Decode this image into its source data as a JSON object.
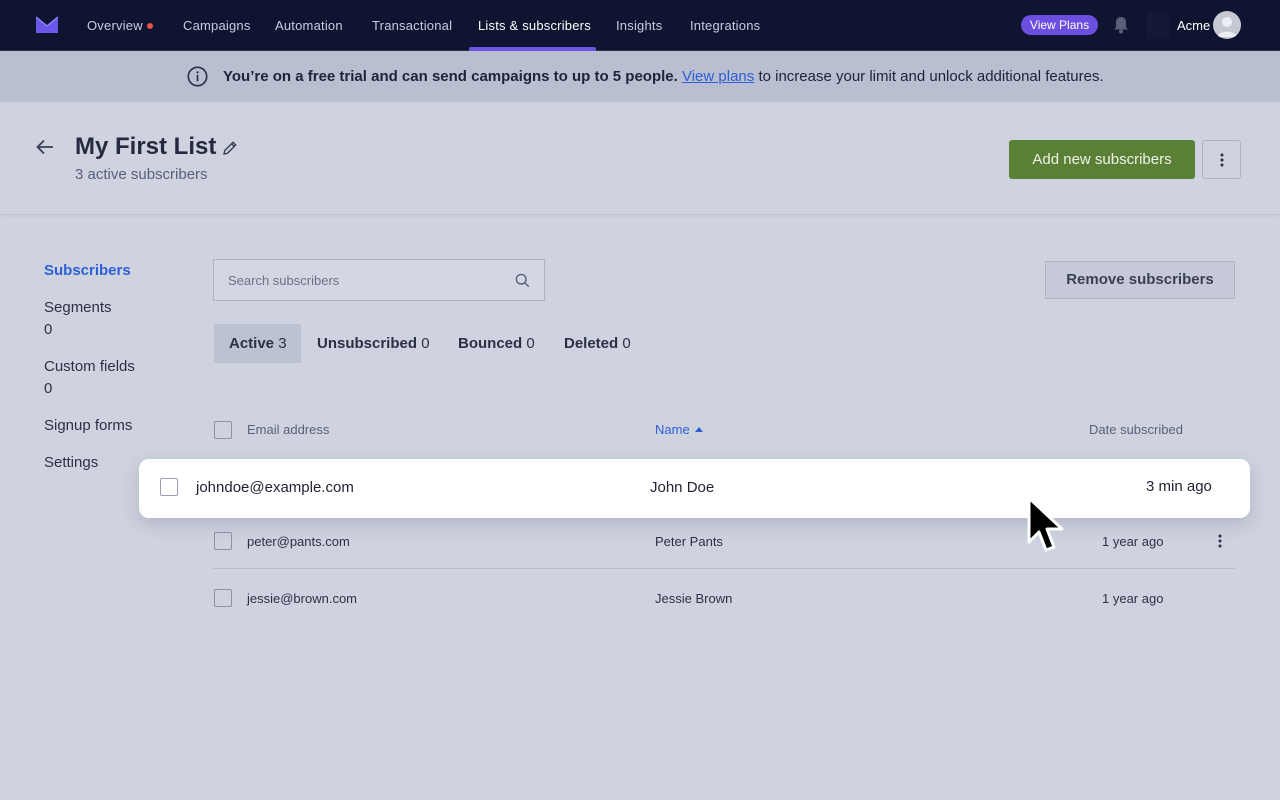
{
  "nav": {
    "items": [
      "Overview",
      "Campaigns",
      "Automation",
      "Transactional",
      "Lists & subscribers",
      "Insights",
      "Integrations"
    ],
    "active": "Lists & subscribers",
    "view_plans": "View Plans",
    "org": "Acme"
  },
  "banner": {
    "bold_text": "You’re on a free trial and can send campaigns to up to 5 people.",
    "link_text": "View plans",
    "tail_text": "to increase your limit and unlock additional features."
  },
  "header": {
    "title": "My First List",
    "subtitle": "3 active subscribers",
    "add_button": "Add new subscribers"
  },
  "sidebar": {
    "items": [
      {
        "label": "Subscribers",
        "count": ""
      },
      {
        "label": "Segments",
        "count": "0"
      },
      {
        "label": "Custom fields",
        "count": "0"
      },
      {
        "label": "Signup forms",
        "count": ""
      },
      {
        "label": "Settings",
        "count": ""
      }
    ]
  },
  "search": {
    "placeholder": "Search subscribers"
  },
  "remove_button": "Remove subscribers",
  "tabs": [
    {
      "label": "Active",
      "count": "3"
    },
    {
      "label": "Unsubscribed",
      "count": "0"
    },
    {
      "label": "Bounced",
      "count": "0"
    },
    {
      "label": "Deleted",
      "count": "0"
    }
  ],
  "table": {
    "columns": [
      "Email address",
      "Name",
      "Date subscribed"
    ],
    "rows": [
      {
        "email": "johndoe@example.com",
        "name": "John Doe",
        "date": "3 min ago"
      },
      {
        "email": "peter@pants.com",
        "name": "Peter Pants",
        "date": "1 year ago"
      },
      {
        "email": "jessie@brown.com",
        "name": "Jessie Brown",
        "date": "1 year ago"
      }
    ]
  },
  "colors": {
    "nav_bg": "#0f1430",
    "accent": "#6a4fe0",
    "link": "#2d5fd6",
    "primary_button": "#5a8036"
  }
}
